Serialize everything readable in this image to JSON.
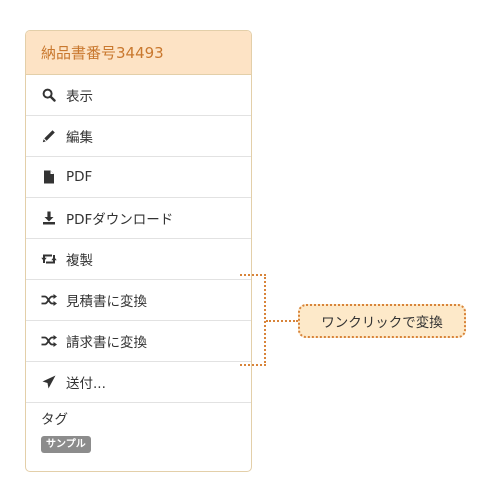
{
  "panel": {
    "title": "納品書番号34493",
    "items": [
      {
        "label": "表示",
        "icon": "search-icon"
      },
      {
        "label": "編集",
        "icon": "pencil-icon"
      },
      {
        "label": "PDF",
        "icon": "file-icon"
      },
      {
        "label": "PDFダウンロード",
        "icon": "download-icon"
      },
      {
        "label": "複製",
        "icon": "retweet-icon"
      },
      {
        "label": "見積書に変換",
        "icon": "shuffle-icon"
      },
      {
        "label": "請求書に変換",
        "icon": "shuffle-icon"
      },
      {
        "label": "送付...",
        "icon": "send-icon"
      }
    ],
    "tags": {
      "heading": "タグ",
      "badge": "サンプル"
    }
  },
  "callout": {
    "text": "ワンクリックで変換"
  },
  "colors": {
    "header_bg": "#fde3c5",
    "header_text": "#c9782e",
    "accent_dotted": "#d8843a",
    "callout_bg": "#fde9c9",
    "badge_bg": "#8c8c8c"
  }
}
